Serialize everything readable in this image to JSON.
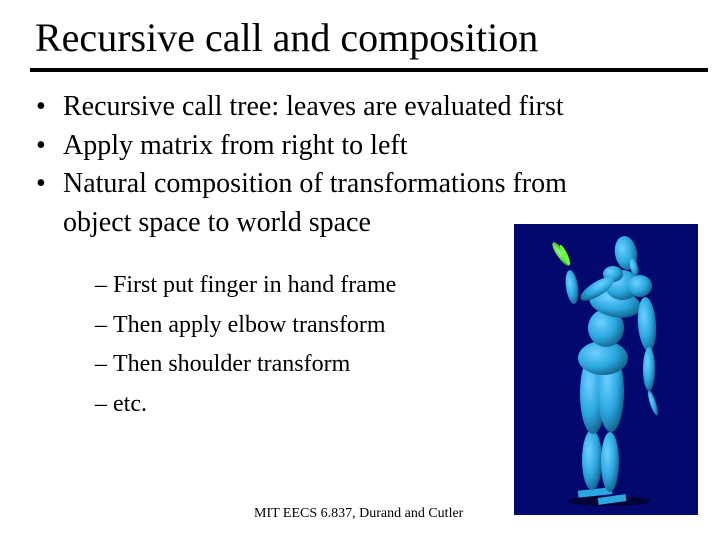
{
  "slide": {
    "title": "Recursive call and composition",
    "bullets": [
      {
        "marker": "•",
        "text": "Recursive call tree: leaves are evaluated first"
      },
      {
        "marker": "•",
        "text": "Apply matrix from right to left"
      },
      {
        "marker": "•",
        "text": "Natural composition of transformations from"
      },
      {
        "marker": "",
        "text": "object space to world space"
      }
    ],
    "sub_bullets": [
      {
        "marker": "–",
        "text": "First put finger in hand frame"
      },
      {
        "marker": "–",
        "text": "Then apply elbow transform"
      },
      {
        "marker": "–",
        "text": "Then shoulder transform"
      },
      {
        "marker": "–",
        "text": "etc."
      }
    ],
    "figure": {
      "description": "3D articulated ellipsoid human figure with green leaf in hand",
      "colors": {
        "background": "#02086e",
        "body": "#2aa7e0",
        "leaf": "#33dd22"
      }
    },
    "footer": "MIT EECS 6.837, Durand and Cutler"
  }
}
